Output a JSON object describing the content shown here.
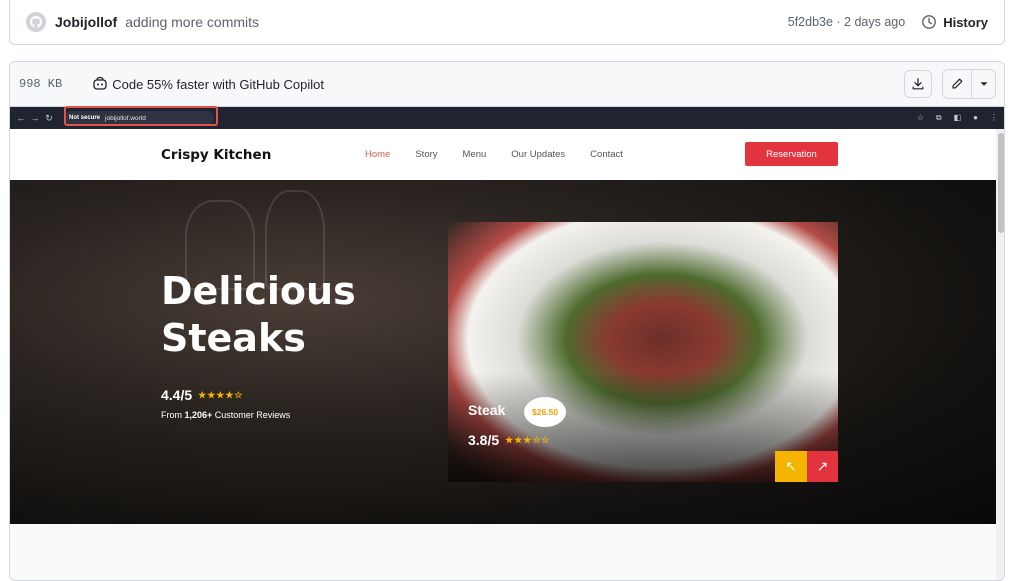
{
  "commit": {
    "author": "Jobijollof",
    "message": "adding more commits",
    "sha_time": "5f2db3e · 2 days ago",
    "history_label": "History"
  },
  "file": {
    "size": "998 KB",
    "copilot_text": "Code 55% faster with GitHub Copilot"
  },
  "browser": {
    "security_label": "Not secure",
    "url": "jobijollof.world"
  },
  "site": {
    "brand": "Crispy Kitchen",
    "menu": [
      "Home",
      "Story",
      "Menu",
      "Our Updates",
      "Contact"
    ],
    "reservation": "Reservation",
    "hero_title_1": "Delicious",
    "hero_title_2": "Steaks",
    "hero_rating": "4.4/5",
    "hero_stars": "★★★★☆",
    "reviews_prefix": "From ",
    "reviews_count": "1,206+",
    "reviews_suffix": " Customer Reviews",
    "dish_name": "Steak",
    "dish_price": "$26.50",
    "dish_rating": "3.8/5",
    "dish_stars": "★★★☆☆",
    "arrow_prev": "↖",
    "arrow_next": "↗"
  },
  "colors": {
    "accent_red": "#e2333f",
    "accent_yellow": "#f5b400",
    "highlight": "#e5534b"
  }
}
